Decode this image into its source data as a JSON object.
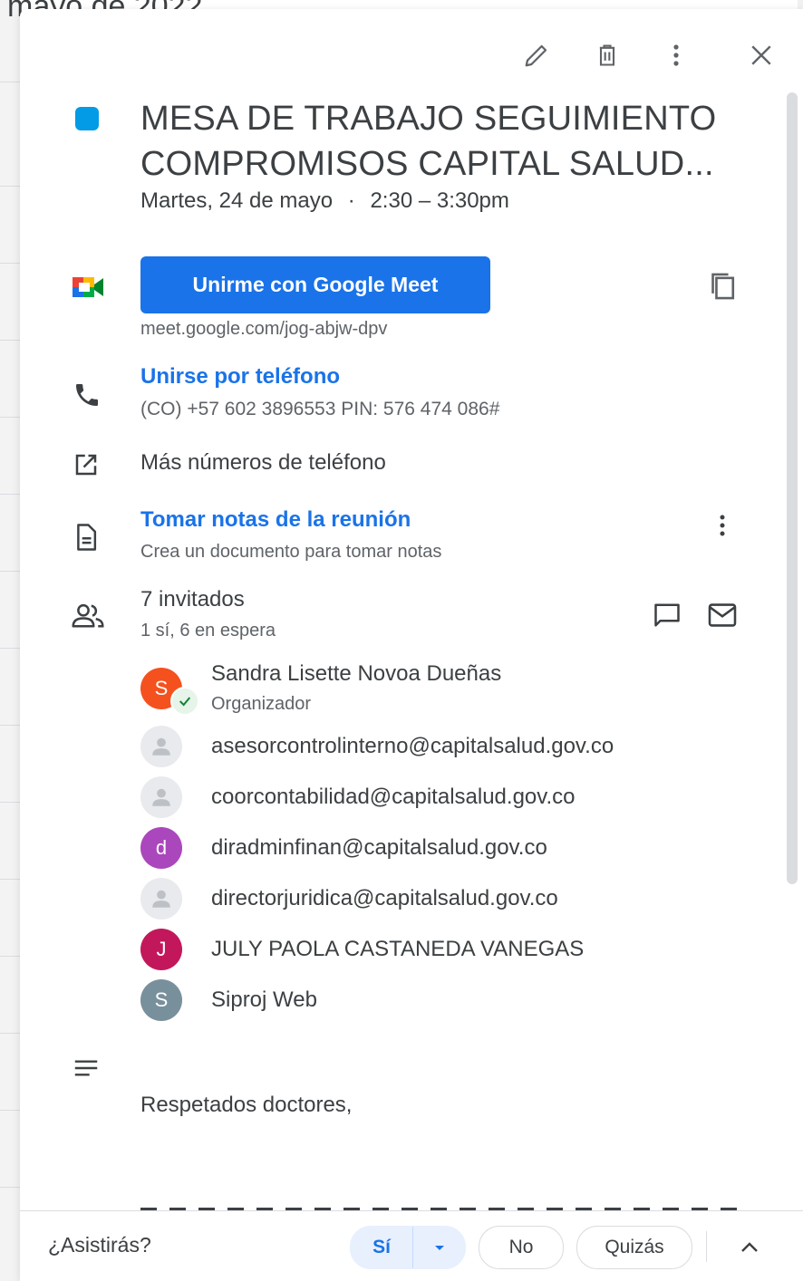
{
  "background": {
    "title": "mayo de 2022"
  },
  "toolbar": {
    "edit_icon": "pencil-icon",
    "delete_icon": "trash-icon",
    "more_icon": "more-vert-icon",
    "close_icon": "close-icon"
  },
  "event": {
    "color": "#039be5",
    "title": "MESA DE TRABAJO SEGUIMIENTO COMPROMISOS CAPITAL SALUD...",
    "date": "Martes, 24 de mayo",
    "separator": "·",
    "time": "2:30 – 3:30pm"
  },
  "meet": {
    "button_label": "Unirme con Google Meet",
    "link": "meet.google.com/jog-abjw-dpv"
  },
  "phone": {
    "label": "Unirse por teléfono",
    "details": "(CO) +57 602 3896553 PIN: 576 474 086#",
    "more_numbers": "Más números de teléfono"
  },
  "notes": {
    "label": "Tomar notas de la reunión",
    "subtitle": "Crea un documento para tomar notas"
  },
  "guests": {
    "count_label": "7 invitados",
    "status_label": "1 sí, 6 en espera",
    "list": [
      {
        "initial": "S",
        "name": "Sandra Lisette Novoa Dueñas",
        "role": "Organizador",
        "color": "#f4511e"
      },
      {
        "initial": "",
        "name": "asesorcontrolinterno@capitalsalud.gov.co",
        "color": "#e8eaed"
      },
      {
        "initial": "",
        "name": "coorcontabilidad@capitalsalud.gov.co",
        "color": "#e8eaed"
      },
      {
        "initial": "d",
        "name": "diradminfinan@capitalsalud.gov.co",
        "color": "#ab47bc"
      },
      {
        "initial": "",
        "name": "directorjuridica@capitalsalud.gov.co",
        "color": "#e8eaed"
      },
      {
        "initial": "J",
        "name": "JULY PAOLA CASTANEDA VANEGAS",
        "color": "#c2185b"
      },
      {
        "initial": "S",
        "name": "Siproj Web",
        "color": "#78909c"
      }
    ]
  },
  "description": {
    "text": "Respetados doctores,"
  },
  "footer": {
    "question": "¿Asistirás?",
    "yes_label": "Sí",
    "no_label": "No",
    "maybe_label": "Quizás"
  }
}
